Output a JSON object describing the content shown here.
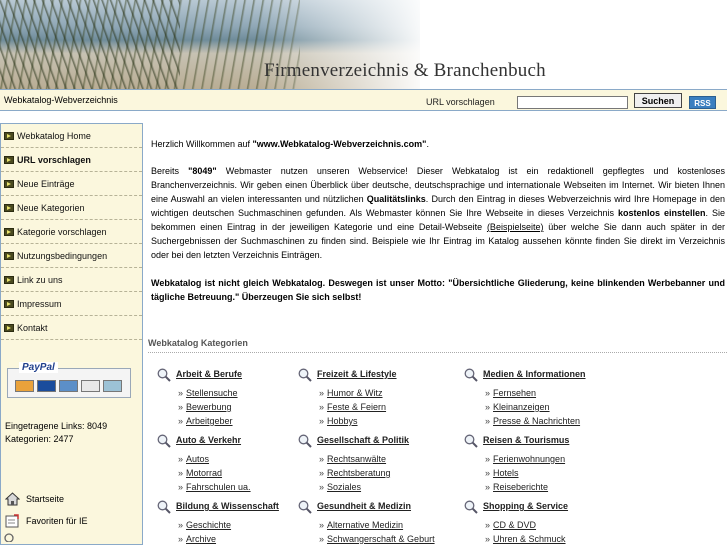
{
  "header": {
    "site_title": "Firmenverzeichnis & Branchenbuch"
  },
  "topbar": {
    "site_name": "Webkatalog-Webverzeichnis",
    "suggest_label": "URL vorschlagen",
    "search_value": "",
    "search_button": "Suchen",
    "rss_label": "RSS"
  },
  "sidebar": {
    "items": [
      {
        "label": "Webkatalog Home"
      },
      {
        "label": "URL vorschlagen"
      },
      {
        "label": "Neue Einträge"
      },
      {
        "label": "Neue Kategorien"
      },
      {
        "label": "Kategorie vorschlagen"
      },
      {
        "label": "Nutzungsbedingungen"
      },
      {
        "label": "Link zu uns"
      },
      {
        "label": "Impressum"
      },
      {
        "label": "Kontakt"
      }
    ],
    "paypal_label": "PayPal",
    "stats_links": "Eingetragene Links: 8049",
    "stats_categories": "Kategorien: 2477",
    "startseite": "Startseite",
    "favoriten": "Favoriten für IE"
  },
  "main": {
    "welcome_prefix": "Herzlich Willkommen auf ",
    "welcome_site": "\"www.Webkatalog-Webverzeichnis.com\"",
    "welcome_suffix": ".",
    "intro_1": "Bereits ",
    "intro_count": "\"8049\"",
    "intro_2": " Webmaster nutzen unseren Webservice! Dieser Webkatalog ist ein redaktionell gepflegtes und kostenloses Branchenverzeichnis. Wir geben einen Überblick über deutsche, deutschsprachige und internationale Webseiten im Internet. Wir bieten Ihnen eine Auswahl an vielen interessanten und nützlichen ",
    "intro_bold1": "Qualitätslinks",
    "intro_3": ". Durch den Eintrag in dieses Webverzeichnis wird Ihre Homepage in den wichtigen deutschen Suchmaschinen gefunden. Als Webmaster können Sie Ihre Webseite in dieses Verzeichnis ",
    "intro_bold2": "kostenlos einstellen",
    "intro_4": ". Sie bekommen einen Eintrag in der jeweiligen Kategorie und eine Detail-Webseite ",
    "intro_link": "(Beispielseite)",
    "intro_5": " über welche Sie dann auch später in der Suchergebnissen der Suchmaschinen zu finden sind. Beispiele wie Ihr Eintrag im Katalog aussehen könnte finden Sie direkt im Verzeichnis oder bei den letzten Verzeichnis Einträgen.",
    "motto": "Webkatalog ist nicht gleich Webkatalog. Deswegen ist unser Motto: \"Übersichtliche Gliederung, keine blinkenden Werbebanner und tägliche Betreuung.\" Überzeugen Sie sich selbst!",
    "categories_heading": "Webkatalog Kategorien",
    "categories": [
      {
        "title": "Arbeit & Berufe",
        "subs": [
          "Stellensuche",
          "Bewerbung",
          "Arbeitgeber"
        ]
      },
      {
        "title": "Freizeit & Lifestyle",
        "subs": [
          "Humor & Witz",
          "Feste & Feiern",
          "Hobbys"
        ]
      },
      {
        "title": "Medien & Informationen",
        "subs": [
          "Fernsehen",
          "Kleinanzeigen",
          "Presse & Nachrichten"
        ]
      },
      {
        "title": "Auto & Verkehr",
        "subs": [
          "Autos",
          "Motorrad",
          "Fahrschulen ua."
        ]
      },
      {
        "title": "Gesellschaft & Politik",
        "subs": [
          "Rechtsanwälte",
          "Rechtsberatung",
          "Soziales"
        ]
      },
      {
        "title": "Reisen & Tourismus",
        "subs": [
          "Ferienwohnungen",
          "Hotels",
          "Reiseberichte"
        ]
      },
      {
        "title": "Bildung & Wissenschaft",
        "subs": [
          "Geschichte",
          "Archive"
        ]
      },
      {
        "title": "Gesundheit & Medizin",
        "subs": [
          "Alternative Medizin",
          "Schwangerschaft & Geburt"
        ]
      },
      {
        "title": "Shopping & Service",
        "subs": [
          "CD & DVD",
          "Uhren & Schmuck"
        ]
      }
    ],
    "arrow": "»"
  }
}
